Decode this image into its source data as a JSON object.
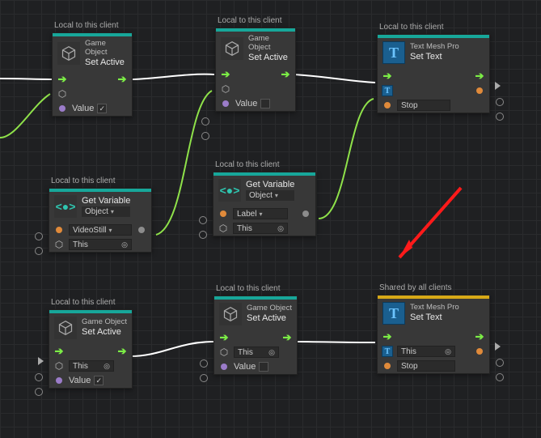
{
  "scope": {
    "local": "Local to this client",
    "shared": "Shared by all clients"
  },
  "modules": {
    "gameobject": "Game Object",
    "tmp": "Text Mesh Pro"
  },
  "actions": {
    "setactive": "Set Active",
    "getvar": "Get Variable",
    "settext": "Set Text"
  },
  "labels": {
    "value": "Value",
    "label": "Label",
    "this": "This",
    "object": "Object"
  },
  "values": {
    "videostill": "VideoStill",
    "stop": "Stop"
  }
}
